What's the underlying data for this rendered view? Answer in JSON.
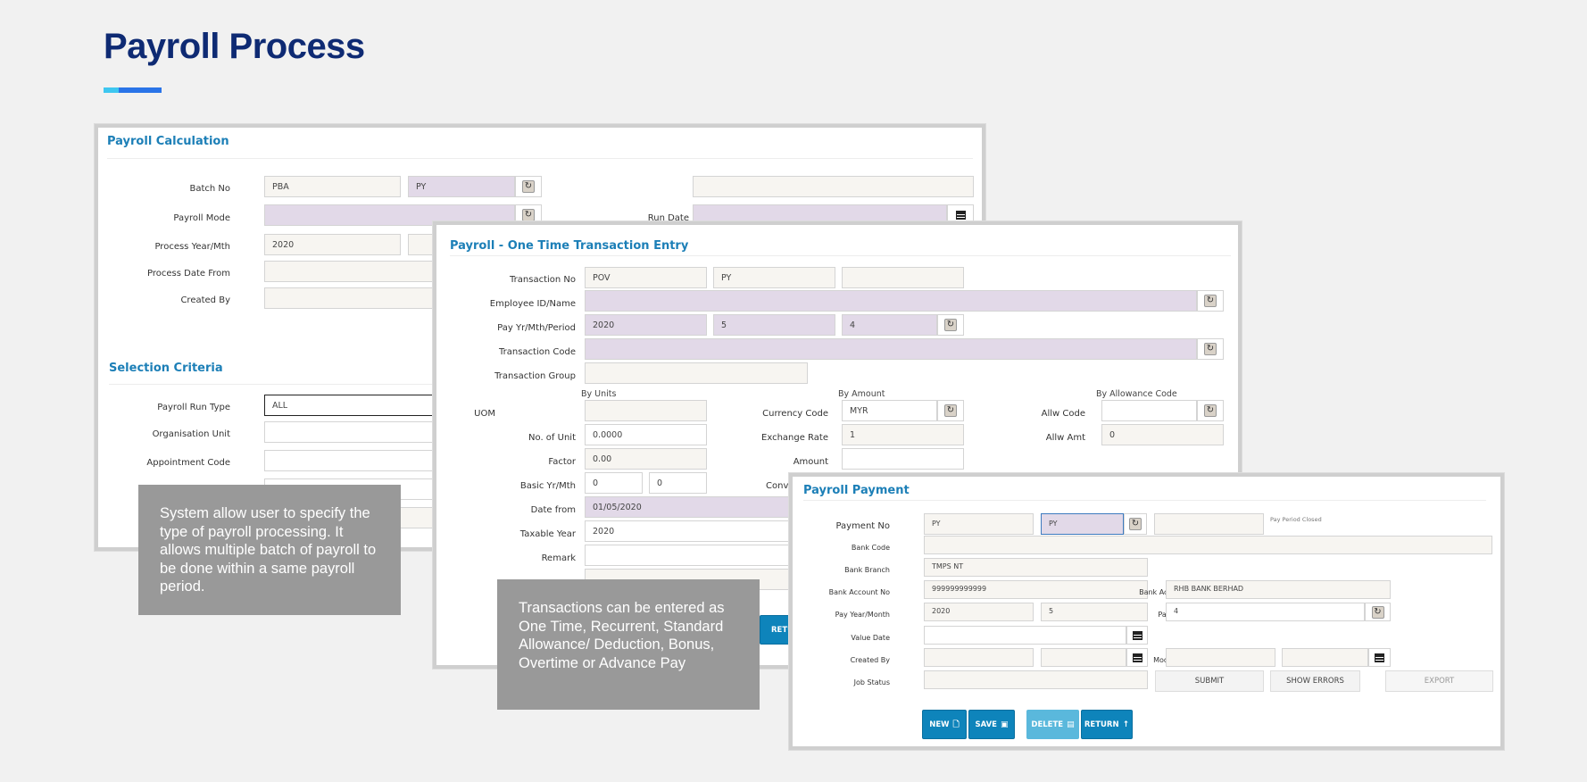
{
  "page": {
    "title": "Payroll Process",
    "accent_colors": {
      "title": "#0e2a73",
      "bar_light": "#3ec7f0",
      "bar_dark": "#2a74e8",
      "window_title": "#1c7fb7",
      "button": "#0e84bb"
    }
  },
  "calc": {
    "title": "Payroll Calculation",
    "batch_no_label": "Batch No",
    "batch_no_1": "PBA",
    "batch_no_2": "PY",
    "batch_no_3": "",
    "payroll_mode_label": "Payroll Mode",
    "payroll_mode": "",
    "run_date_label": "Run Date",
    "run_date": "",
    "process_year_label": "Process Year/Mth",
    "process_year": "2020",
    "process_month": "",
    "process_date_from_label": "Process Date From",
    "process_date_from": "",
    "created_by_label": "Created By",
    "created_by": "",
    "selection_title": "Selection Criteria",
    "run_type_label": "Payroll Run Type",
    "run_type": "ALL",
    "org_unit_label": "Organisation Unit",
    "org_unit": "",
    "appt_code_label": "Appointment Code",
    "appt_code": ""
  },
  "txn": {
    "title": "Payroll - One Time Transaction Entry",
    "txn_no_label": "Transaction No",
    "txn_no_1": "POV",
    "txn_no_2": "PY",
    "txn_no_3": "",
    "emp_label": "Employee ID/Name",
    "emp": "",
    "pay_period_label": "Pay Yr/Mth/Period",
    "pay_year": "2020",
    "pay_month": "5",
    "pay_period": "4",
    "txn_code_label": "Transaction Code",
    "txn_code": "",
    "txn_group_label": "Transaction Group",
    "txn_group": "",
    "by_units": "By Units",
    "by_amount": "By Amount",
    "by_allowance": "By Allowance Code",
    "uom_label": "UOM",
    "uom": "",
    "units_label": "No. of Unit",
    "units": "0.0000",
    "factor_label": "Factor",
    "factor": "0.00",
    "basic_label": "Basic Yr/Mth",
    "basic_yr": "0",
    "basic_mth": "0",
    "date_from_label": "Date from",
    "date_from": "01/05/2020",
    "taxable_year_label": "Taxable Year",
    "taxable_year": "2020",
    "remark_label": "Remark",
    "remark": "",
    "currency_label": "Currency Code",
    "currency": "MYR",
    "exch_label": "Exchange Rate",
    "exch": "1",
    "amount_label": "Amount",
    "amount": "",
    "conv_label": "Conve",
    "allw_code_label": "Allw Code",
    "allw_code": "",
    "allw_amt_label": "Allw Amt",
    "allw_amt": "0",
    "return_partial": "RETU"
  },
  "payment": {
    "title": "Payroll Payment",
    "payment_no_label": "Payment No",
    "payment_no_1": "PY",
    "payment_no_2": "PY",
    "payment_no_3": "",
    "pay_period_closed": "Pay Period Closed",
    "bank_code_label": "Bank Code",
    "bank_code": "",
    "bank_branch_label": "Bank Branch",
    "bank_branch": "TMPS NT",
    "bank_acc_no_label": "Bank Account No",
    "bank_acc_no": "999999999999",
    "bank_acc_name_label": "Bank Acc Name",
    "bank_acc_name": "RHB BANK BERHAD",
    "pay_ym_label": "Pay Year/Month",
    "pay_year": "2020",
    "pay_month": "5",
    "pay_period_label": "Pay Period",
    "pay_period": "4",
    "value_date_label": "Value Date",
    "value_date": "",
    "created_by_label": "Created By",
    "created_by": "",
    "created_date": "",
    "modified_by_label": "Modified By",
    "modified_by": "",
    "modified_date": "",
    "job_status_label": "Job Status",
    "job_status": "",
    "submit": "SUBMIT",
    "show_errors": "SHOW ERRORS",
    "export": "EXPORT",
    "new": "NEW",
    "save": "SAVE",
    "delete": "DELETE",
    "return": "RETURN"
  },
  "notes": {
    "calc_note": "System allow user to specify the type of payroll processing. It allows multiple batch of payroll to be done within a same payroll period.",
    "txn_note": "Transactions can be entered as One Time, Recurrent, Standard Allowance/ Deduction, Bonus, Overtime or Advance Pay"
  }
}
